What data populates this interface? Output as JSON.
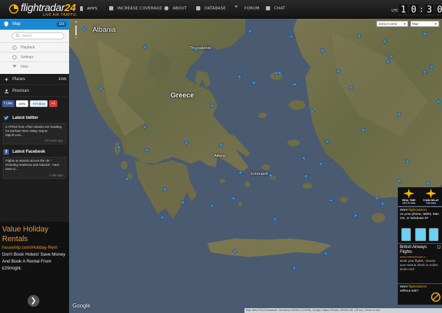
{
  "brand": {
    "name_a": "flightradar",
    "name_b": "24",
    "tagline": "LIVE AIR TRAFFIC"
  },
  "nav": [
    {
      "label": "APPS",
      "icon": "phone-icon"
    },
    {
      "label": "INCREASE COVERAGE",
      "icon": "antenna-icon"
    },
    {
      "label": "ABOUT",
      "icon": "info-icon"
    },
    {
      "label": "DATABASE",
      "icon": "database-icon"
    },
    {
      "label": "FORUM",
      "icon": "quote-icon"
    },
    {
      "label": "CHAT",
      "icon": "chat-icon"
    }
  ],
  "clock": {
    "utc_label": "UTC",
    "d1": "1",
    "d2": "0",
    "d3": "3",
    "d4": "0"
  },
  "sidebar": {
    "map_label": "Map",
    "map_count": "119",
    "search_placeholder": "Search",
    "panel_items": [
      "Playback",
      "Settings",
      "Filter"
    ],
    "planes_label": "Planes",
    "planes_count": "4348",
    "premium_label": "Premium",
    "social": {
      "like": "Like",
      "like_count": "287k",
      "follow": "Follow",
      "gplus": "+1"
    },
    "twitter": {
      "heading": "Latest twitter",
      "text": "2 ATR42 from UTair Ukraine are heading for Durham Tees Valley Airport http://t.co/s...",
      "time": "23 hours ago"
    },
    "facebook": {
      "heading": "Latest Facebook",
      "text": "Flights at airports across the UK - including Heathrow and Gatwick - have been d...",
      "time": "1 day ago"
    }
  },
  "ad_left": {
    "title": "Value Holiday Rentals",
    "url": "housetrip.com/Holiday-Rent",
    "body": "Don't Book Hotels! Save Money And Book A Rental From £29/night.",
    "go": "❯"
  },
  "map": {
    "countries": [
      "Albania",
      "Greece"
    ],
    "cities": [
      "Thessaloniki",
      "Athens",
      "Ermoupoli"
    ],
    "jump_to_area": "Jump to area",
    "map_type": "Map",
    "zoom_in": "+",
    "zoom_out": "−",
    "google": "Google",
    "attribution": "Map data ©2013 Basarsoft, GeoBasis-DE/BKG (©2009), Google, Mapa GISrael, ORION-ME | 50 km | Terms of Use",
    "water_color": "#4a5a70",
    "land_color": "#6b6b45",
    "plane_color": "#3fa0ff"
  },
  "right_ads": {
    "realtime": {
      "left_title": "REAL TIME",
      "left_sub": "ADS-B data",
      "right_title": "5 MIN DELAY",
      "right_sub": "FAA data"
    },
    "app": {
      "line1": "Want",
      "brand": "flightradar24",
      "line2": "on your phone, tablet, Mac OS, or Windows 8?"
    },
    "ba": {
      "title": "British Airways Flights",
      "url": "www.britishairways.c...",
      "body": "Book your flights, choose your seat & check in online at BA.com"
    },
    "free": {
      "line1": "Want",
      "brand": "flightradar24",
      "line2": "without ads?"
    }
  }
}
